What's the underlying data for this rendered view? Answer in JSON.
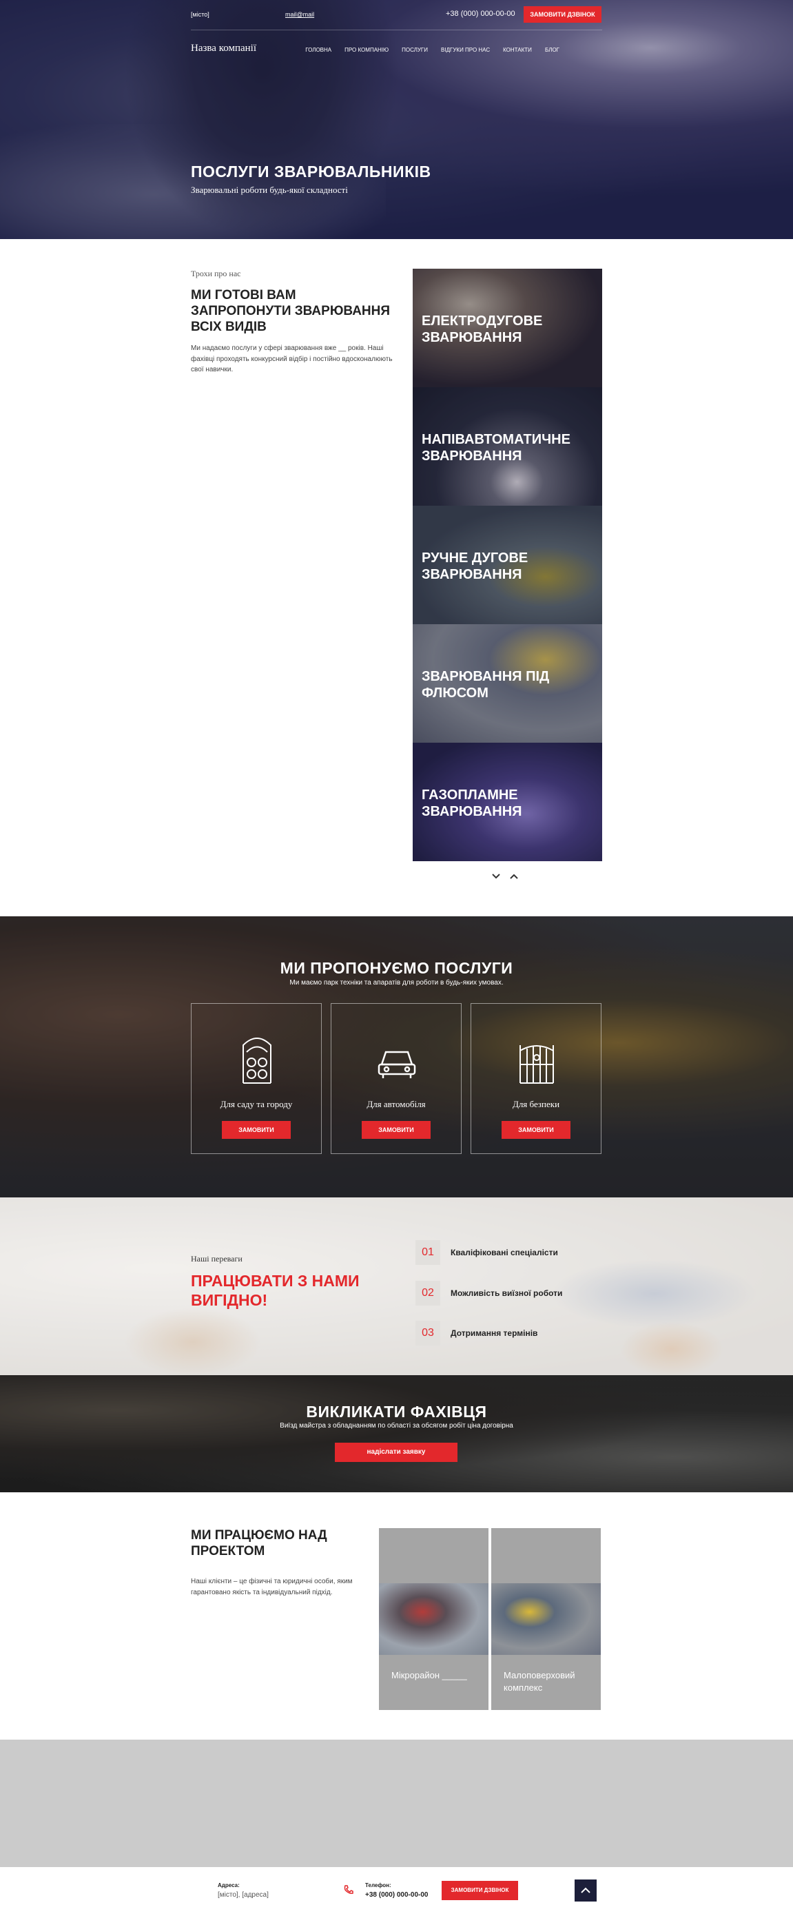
{
  "topbar": {
    "city": "[місто]",
    "email": "mail@mail",
    "phone": "+38 (000) 000-00-00",
    "call_button": "Замовити дзвінок"
  },
  "nav": {
    "brand": "Назва компанії",
    "items": [
      "Головна",
      "Про компанію",
      "Послуги",
      "Відгуки про нас",
      "Контакти",
      "Блог"
    ]
  },
  "hero": {
    "title": "ПОСЛУГИ ЗВАРЮВАЛЬНИКІВ",
    "subtitle": "Зварювальні роботи будь-якої складності"
  },
  "about": {
    "small": "Трохи про нас",
    "title": "МИ ГОТОВІ ВАМ ЗАПРОПОНУТИ ЗВАРЮВАННЯ ВСІХ ВИДІВ",
    "text": "Ми надаємо послуги у сфері зварювання вже __ років. Наші фахівці проходять конкурсний відбір і постійно вдосконалюють свої навички."
  },
  "welding_types": [
    {
      "title": "ЕЛЕКТРОДУГОВЕ ЗВАРЮВАННЯ"
    },
    {
      "title": "НАПІВАВТОМАТИЧНЕ ЗВАРЮВАННЯ"
    },
    {
      "title": "РУЧНЕ ДУГОВЕ ЗВАРЮВАННЯ"
    },
    {
      "title": "ЗВАРЮВАННЯ ПІД ФЛЮСОМ"
    },
    {
      "title": "ГАЗОПЛАМНЕ ЗВАРЮВАННЯ"
    }
  ],
  "carousel": {
    "down_icon": "chevron-down-icon",
    "up_icon": "chevron-up-icon"
  },
  "services": {
    "title": "МИ ПРОПОНУЄМО ПОСЛУГИ",
    "subtitle": "Ми маємо парк техніки та апаратів для роботи в будь-яких умовах.",
    "items": [
      {
        "label": "Для саду та городу",
        "icon": "garden-gate-icon",
        "button": "Замовити"
      },
      {
        "label": "Для автомобіля",
        "icon": "car-icon",
        "button": "Замовити"
      },
      {
        "label": "Для безпеки",
        "icon": "fence-gate-icon",
        "button": "Замовити"
      }
    ]
  },
  "advantages": {
    "small": "Наші переваги",
    "title": "ПРАЦЮВАТИ З НАМИ ВИГІДНО!",
    "items": [
      {
        "num": "01",
        "text": "Кваліфіковані спеціалісти"
      },
      {
        "num": "02",
        "text": "Можливість виїзної роботи"
      },
      {
        "num": "03",
        "text": "Дотримання термінів"
      }
    ]
  },
  "call": {
    "title": "ВИКЛИКАТИ ФАХІВЦЯ",
    "subtitle": "Виїзд майстра з обладнанням по області за обсягом робіт ціна договірна",
    "button": "надіслати заявку"
  },
  "projects": {
    "title": "МИ ПРАЦЮЄМО НАД ПРОЕКТОМ",
    "text": "Наші клієнти – це фізичні та юридичні особи, яким гарантовано якість та індивідуальний підхід.",
    "items": [
      {
        "label": "Мікрорайон _____"
      },
      {
        "label": "Малоповерховий комплекс"
      }
    ]
  },
  "footer": {
    "address_label": "Адреса:",
    "address_value": "[місто], [адреса]",
    "phone_label": "Телефон:",
    "phone_value": "+38 (000) 000-00-00",
    "call_button": "Замовити дзвінок",
    "to_top_icon": "chevron-up-icon"
  },
  "colors": {
    "accent": "#e3282c",
    "dark": "#1c1f3a",
    "placeholder_gray": "#cbcbcb"
  }
}
